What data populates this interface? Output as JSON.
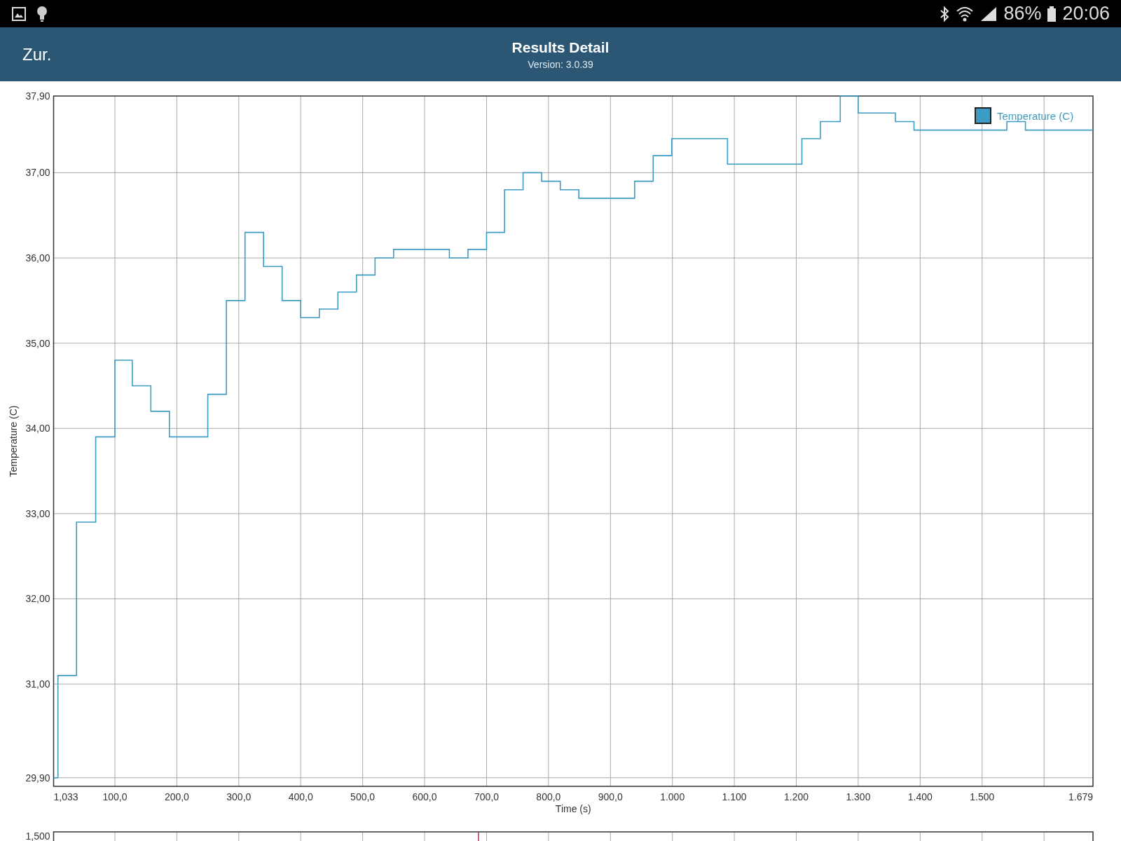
{
  "status_bar": {
    "battery_percent": "86%",
    "time": "20:06"
  },
  "header": {
    "back": "Zur.",
    "title": "Results Detail",
    "subtitle": "Version: 3.0.39"
  },
  "chart": {
    "chart_data": {
      "type": "line",
      "xlabel": "Time (s)",
      "ylabel": "Temperature (C)",
      "xlim": [
        1.033,
        1679
      ],
      "grid": true,
      "xticks": [
        {
          "value": 100,
          "label": "100,0"
        },
        {
          "value": 200,
          "label": "200,0"
        },
        {
          "value": 300,
          "label": "300,0"
        },
        {
          "value": 400,
          "label": "400,0"
        },
        {
          "value": 500,
          "label": "500,0"
        },
        {
          "value": 600,
          "label": "600,0"
        },
        {
          "value": 700,
          "label": "700,0"
        },
        {
          "value": 800,
          "label": "800,0"
        },
        {
          "value": 900,
          "label": "900,0"
        }
      ],
      "ylim": [
        29.8,
        37.9
      ],
      "yticks": [
        {
          "value": 29.9,
          "label": "29,90"
        },
        {
          "value": 31,
          "label": "31,00"
        },
        {
          "value": 32,
          "label": "32,00"
        },
        {
          "value": 33,
          "label": "33,00"
        },
        {
          "value": 34,
          "label": "34,00"
        },
        {
          "value": 35,
          "label": "35,00"
        },
        {
          "value": 36,
          "label": "36,00"
        },
        {
          "value": 37,
          "label": "37,00"
        },
        {
          "value": 37.9,
          "label": "37,90"
        }
      ],
      "x": [
        1.033,
        8,
        8,
        38,
        38,
        69,
        69,
        100,
        100,
        128,
        128,
        158,
        158,
        188,
        188,
        250,
        250,
        280,
        280,
        310,
        310,
        340,
        340,
        370,
        370,
        400,
        400,
        430,
        430,
        460,
        460,
        490,
        490,
        520,
        520,
        550,
        550,
        640,
        640,
        670,
        670,
        700,
        700,
        729,
        729,
        759,
        759,
        789,
        789,
        819,
        819,
        849,
        849,
        939,
        939,
        969,
        969,
        999,
        999,
        1089,
        1089,
        1209,
        1209,
        1239,
        1239,
        1271,
        1271,
        1300,
        1300,
        1360,
        1360,
        1390,
        1390,
        1540,
        1540,
        1570,
        1570,
        1679
      ],
      "series": [
        {
          "name": "Temperature (C)",
          "color": "#3d9cc4",
          "values": [
            29.9,
            29.9,
            31.1,
            31.1,
            32.9,
            32.9,
            33.9,
            33.9,
            34.8,
            34.8,
            34.5,
            34.5,
            34.2,
            34.2,
            33.9,
            33.9,
            34.4,
            34.4,
            35.5,
            35.5,
            36.3,
            36.3,
            35.9,
            35.9,
            35.5,
            35.5,
            35.3,
            35.3,
            35.4,
            35.4,
            35.6,
            35.6,
            35.8,
            35.8,
            36.0,
            36.0,
            36.1,
            36.1,
            36.0,
            36.0,
            36.1,
            36.1,
            36.3,
            36.3,
            36.8,
            36.8,
            37.0,
            37.0,
            36.9,
            36.9,
            36.8,
            36.8,
            36.7,
            36.7,
            36.9,
            36.9,
            37.2,
            37.2,
            37.4,
            37.4,
            37.1,
            37.1,
            37.4,
            37.4,
            37.6,
            37.6,
            37.9,
            37.9,
            37.7,
            37.7,
            37.6,
            37.6,
            37.5,
            37.5,
            37.6,
            37.6,
            37.5,
            37.5
          ]
        }
      ]
    }
  },
  "x_start_label": "1,033",
  "x_end_label": "1.679",
  "x_thousands_labels": [
    "1.000",
    "1.100",
    "1.200",
    "1.300",
    "1.400",
    "1.500"
  ],
  "overview_chart": {
    "y_label": "1,500"
  }
}
